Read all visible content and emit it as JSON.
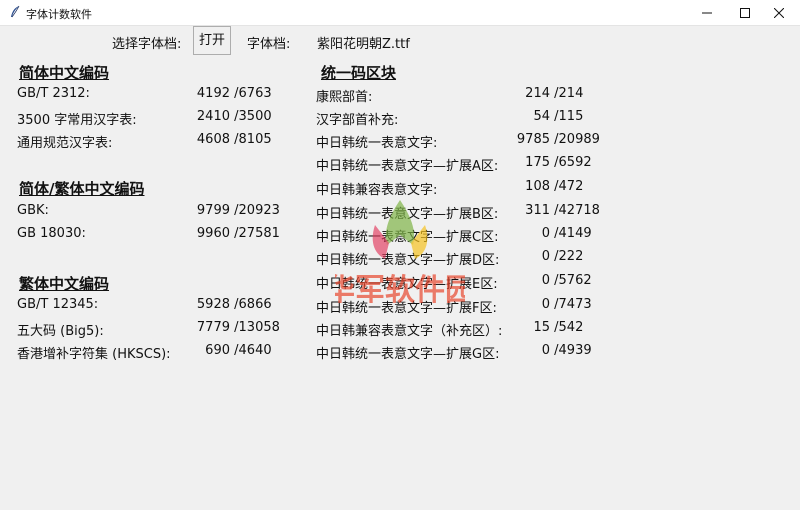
{
  "window": {
    "title": "字体计数软件",
    "minimize_icon": "minimize-icon",
    "maximize_icon": "maximize-icon",
    "close_icon": "close-icon"
  },
  "toolbar": {
    "select_label": "选择字体档:",
    "open_button": "打开",
    "font_file_label": "字体档:",
    "font_file_value": "紫阳花明朝Z.ttf"
  },
  "sections_left": [
    {
      "heading": "简体中文编码",
      "rows": [
        {
          "label": "GB/T 2312:",
          "count": "4192",
          "total": "/6763"
        },
        {
          "label": "3500 字常用汉字表:",
          "count": "2410",
          "total": "/3500"
        },
        {
          "label": "通用规范汉字表:",
          "count": "4608",
          "total": "/8105"
        }
      ]
    },
    {
      "heading": "简体/繁体中文编码",
      "rows": [
        {
          "label": "GBK:",
          "count": "9799",
          "total": "/20923"
        },
        {
          "label": "GB 18030:",
          "count": "9960",
          "total": "/27581"
        }
      ]
    },
    {
      "heading": "繁体中文编码",
      "rows": [
        {
          "label": "GB/T 12345:",
          "count": "5928",
          "total": "/6866"
        },
        {
          "label": "五大码 (Big5):",
          "count": "7779",
          "total": "/13058"
        },
        {
          "label": "香港增补字符集 (HKSCS):",
          "count": "690",
          "total": "/4640"
        }
      ]
    }
  ],
  "section_right": {
    "heading": "统一码区块",
    "rows": [
      {
        "label": "康熙部首:",
        "count": "214",
        "total": "/214"
      },
      {
        "label": "汉字部首补充:",
        "count": "54",
        "total": "/115"
      },
      {
        "label": "中日韩统一表意文字:",
        "count": "9785",
        "total": "/20989"
      },
      {
        "label": "中日韩统一表意文字—扩展A区:",
        "count": "175",
        "total": "/6592"
      },
      {
        "label": "中日韩兼容表意文字:",
        "count": "108",
        "total": "/472"
      },
      {
        "label": "中日韩统一表意文字—扩展B区:",
        "count": "311",
        "total": "/42718"
      },
      {
        "label": "中日韩统一表意文字—扩展C区:",
        "count": "0",
        "total": "/4149"
      },
      {
        "label": "中日韩统一表意文字—扩展D区:",
        "count": "0",
        "total": "/222"
      },
      {
        "label": "中日韩统一表意文字—扩展E区:",
        "count": "0",
        "total": "/5762"
      },
      {
        "label": "中日韩统一表意文字—扩展F区:",
        "count": "0",
        "total": "/7473"
      },
      {
        "label": "中日韩兼容表意文字（补充区）:",
        "count": "15",
        "total": "/542"
      },
      {
        "label": "中日韩统一表意文字—扩展G区:",
        "count": "0",
        "total": "/4939"
      }
    ]
  },
  "watermark": {
    "text": "华军软件园",
    "colors": {
      "red": "#e8432a",
      "orange": "#f5a623",
      "green": "#7cb342",
      "pink": "#e2345a",
      "yellow": "#f6c21b"
    }
  }
}
